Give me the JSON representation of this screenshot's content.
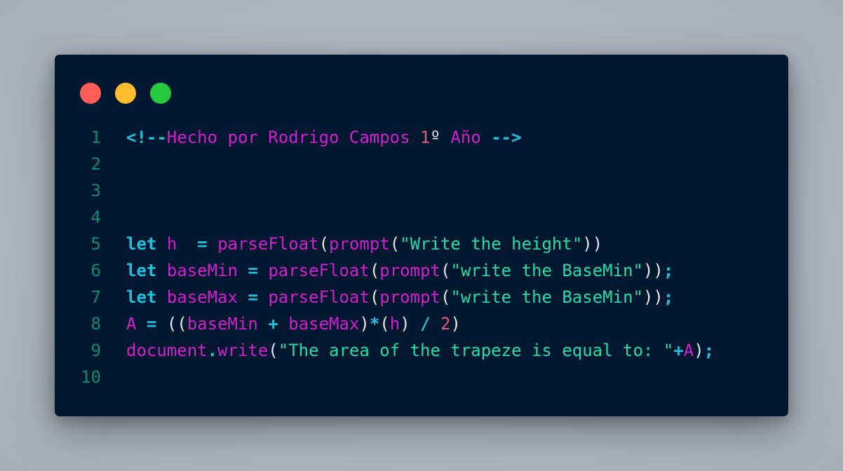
{
  "window": {
    "controls": [
      {
        "name": "close",
        "color": "#ff5f56"
      },
      {
        "name": "minimize",
        "color": "#ffbd2e"
      },
      {
        "name": "maximize",
        "color": "#27c93f"
      }
    ]
  },
  "editor": {
    "line_numbers": [
      "1",
      "2",
      "3",
      "4",
      "5",
      "6",
      "7",
      "8",
      "9",
      "10"
    ],
    "lines": [
      [
        {
          "t": "<!--",
          "c": "ct"
        },
        {
          "t": "Hecho por Rodrigo Campos ",
          "c": "cm"
        },
        {
          "t": "1",
          "c": "nm"
        },
        {
          "t": "º",
          "c": "pl"
        },
        {
          "t": " Año ",
          "c": "cm"
        },
        {
          "t": "-->",
          "c": "ct"
        }
      ],
      [],
      [],
      [],
      [
        {
          "t": "let",
          "c": "kw"
        },
        {
          "t": " ",
          "c": "pl"
        },
        {
          "t": "h",
          "c": "id"
        },
        {
          "t": "  ",
          "c": "pl"
        },
        {
          "t": "=",
          "c": "op"
        },
        {
          "t": " ",
          "c": "pl"
        },
        {
          "t": "parseFloat",
          "c": "fn"
        },
        {
          "t": "(",
          "c": "pn"
        },
        {
          "t": "prompt",
          "c": "fn"
        },
        {
          "t": "(",
          "c": "pn"
        },
        {
          "t": "\"Write the height\"",
          "c": "st"
        },
        {
          "t": "))",
          "c": "pn"
        }
      ],
      [
        {
          "t": "let",
          "c": "kw"
        },
        {
          "t": " ",
          "c": "pl"
        },
        {
          "t": "baseMin",
          "c": "id"
        },
        {
          "t": " ",
          "c": "pl"
        },
        {
          "t": "=",
          "c": "op"
        },
        {
          "t": " ",
          "c": "pl"
        },
        {
          "t": "parseFloat",
          "c": "fn"
        },
        {
          "t": "(",
          "c": "pn"
        },
        {
          "t": "prompt",
          "c": "fn"
        },
        {
          "t": "(",
          "c": "pn"
        },
        {
          "t": "\"write the BaseMin\"",
          "c": "st"
        },
        {
          "t": "))",
          "c": "pn"
        },
        {
          "t": ";",
          "c": "op"
        }
      ],
      [
        {
          "t": "let",
          "c": "kw"
        },
        {
          "t": " ",
          "c": "pl"
        },
        {
          "t": "baseMax",
          "c": "id"
        },
        {
          "t": " ",
          "c": "pl"
        },
        {
          "t": "=",
          "c": "op"
        },
        {
          "t": " ",
          "c": "pl"
        },
        {
          "t": "parseFloat",
          "c": "fn"
        },
        {
          "t": "(",
          "c": "pn"
        },
        {
          "t": "prompt",
          "c": "fn"
        },
        {
          "t": "(",
          "c": "pn"
        },
        {
          "t": "\"write the BaseMin\"",
          "c": "st"
        },
        {
          "t": "))",
          "c": "pn"
        },
        {
          "t": ";",
          "c": "op"
        }
      ],
      [
        {
          "t": "A",
          "c": "id"
        },
        {
          "t": " ",
          "c": "pl"
        },
        {
          "t": "=",
          "c": "op"
        },
        {
          "t": " ",
          "c": "pl"
        },
        {
          "t": "((",
          "c": "pn"
        },
        {
          "t": "baseMin",
          "c": "id"
        },
        {
          "t": " ",
          "c": "pl"
        },
        {
          "t": "+",
          "c": "op"
        },
        {
          "t": " ",
          "c": "pl"
        },
        {
          "t": "baseMax",
          "c": "id"
        },
        {
          "t": ")",
          "c": "pn"
        },
        {
          "t": "*",
          "c": "op"
        },
        {
          "t": "(",
          "c": "pn"
        },
        {
          "t": "h",
          "c": "id"
        },
        {
          "t": ")",
          "c": "pn"
        },
        {
          "t": " ",
          "c": "pl"
        },
        {
          "t": "/",
          "c": "op"
        },
        {
          "t": " ",
          "c": "pl"
        },
        {
          "t": "2",
          "c": "nm"
        },
        {
          "t": ")",
          "c": "pn"
        }
      ],
      [
        {
          "t": "document",
          "c": "fn"
        },
        {
          "t": ".",
          "c": "op"
        },
        {
          "t": "write",
          "c": "fn"
        },
        {
          "t": "(",
          "c": "pn"
        },
        {
          "t": "\"The area of the trapeze is equal to: \"",
          "c": "st"
        },
        {
          "t": "+",
          "c": "op"
        },
        {
          "t": "A",
          "c": "id"
        },
        {
          "t": ")",
          "c": "pn"
        },
        {
          "t": ";",
          "c": "op"
        }
      ],
      []
    ]
  }
}
